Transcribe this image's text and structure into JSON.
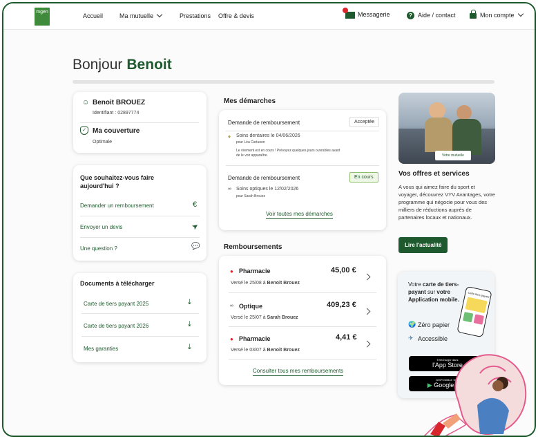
{
  "nav": {
    "logo_text": "mgen",
    "items": [
      "Accueil",
      "Ma mutuelle",
      "Prestations",
      "Offre & devis"
    ],
    "messaging": "Messagerie",
    "help": "Aide / contact",
    "account": "Mon compte"
  },
  "greeting": {
    "prefix": "Bonjour",
    "name": "Benoit"
  },
  "profile": {
    "name": "Benoit BROUEZ",
    "id_label": "Identifiant : 02897774",
    "coverage_title": "Ma couverture",
    "coverage_value": "Optimale"
  },
  "actions": {
    "title_line1": "Que souhaitez-vous faire",
    "title_line2": "aujourd'hui ?",
    "items": [
      {
        "label": "Demander un remboursement",
        "icon": "€"
      },
      {
        "label": "Envoyer un devis",
        "icon": "➤"
      },
      {
        "label": "Une question ?",
        "icon": "💬"
      }
    ]
  },
  "documents": {
    "title": "Documents à télécharger",
    "items": [
      "Carte de tiers payant 2025",
      "Carte de tiers payant 2026",
      "Mes garanties"
    ]
  },
  "demarches": {
    "title": "Mes démarches",
    "items": [
      {
        "type": "Demande de remboursement",
        "status": "Acceptée",
        "detail": "Soins dentaires le 04/06/2026",
        "person": "pour Léa Cartuoen",
        "note1": "Le virement est en cours ! Prévoyez quelques jours ouvrables avant",
        "note2": "de le voir apparaître."
      },
      {
        "type": "Demande de remboursement",
        "status": "En cours",
        "detail": "Soins optiques le 12/02/2026",
        "person": "pour Sarah Brouez"
      }
    ],
    "link": "Voir toutes mes démarches"
  },
  "remboursements": {
    "title": "Remboursements",
    "items": [
      {
        "label": "Pharmacie",
        "amount": "45,00 €",
        "date_text": "Versé le 25/08 à",
        "person": "Benoit Brouez"
      },
      {
        "label": "Optique",
        "amount": "409,23 €",
        "date_text": "Versé le 25/07 à",
        "person": "Sarah Brouez"
      },
      {
        "label": "Pharmacie",
        "amount": "4,41 €",
        "date_text": "Versé le 03/07 à",
        "person": "Benoit Brouez"
      }
    ],
    "link": "Consulter tous mes remboursements"
  },
  "promo": {
    "image_label": "Votre mutuelle",
    "title": "Vos offres et services",
    "text": "A vous qui aimez faire du sport et voyager, découvrez VYV Avantages, votre programme qui négocie pour vous des milliers de réductions auprès de partenaires locaux et nationaux.",
    "button": "Lire l'actualité"
  },
  "app_card": {
    "line1": "Votre",
    "bold1": "carte de tiers-",
    "bold2": "payant",
    "line2": "sur",
    "bold3": "votre Application",
    "bold4": "mobile.",
    "feature1": "Zéro papier",
    "feature2": "Accessible",
    "appstore_small": "Télécharger dans",
    "appstore": "l'App Store",
    "gplay_small": "DISPONIBLE SUR",
    "gplay": "Google Play",
    "phone_text": "Carte tiers payant"
  },
  "colors": {
    "brand": "#1f5a2e",
    "accent_red": "#d9262c"
  }
}
